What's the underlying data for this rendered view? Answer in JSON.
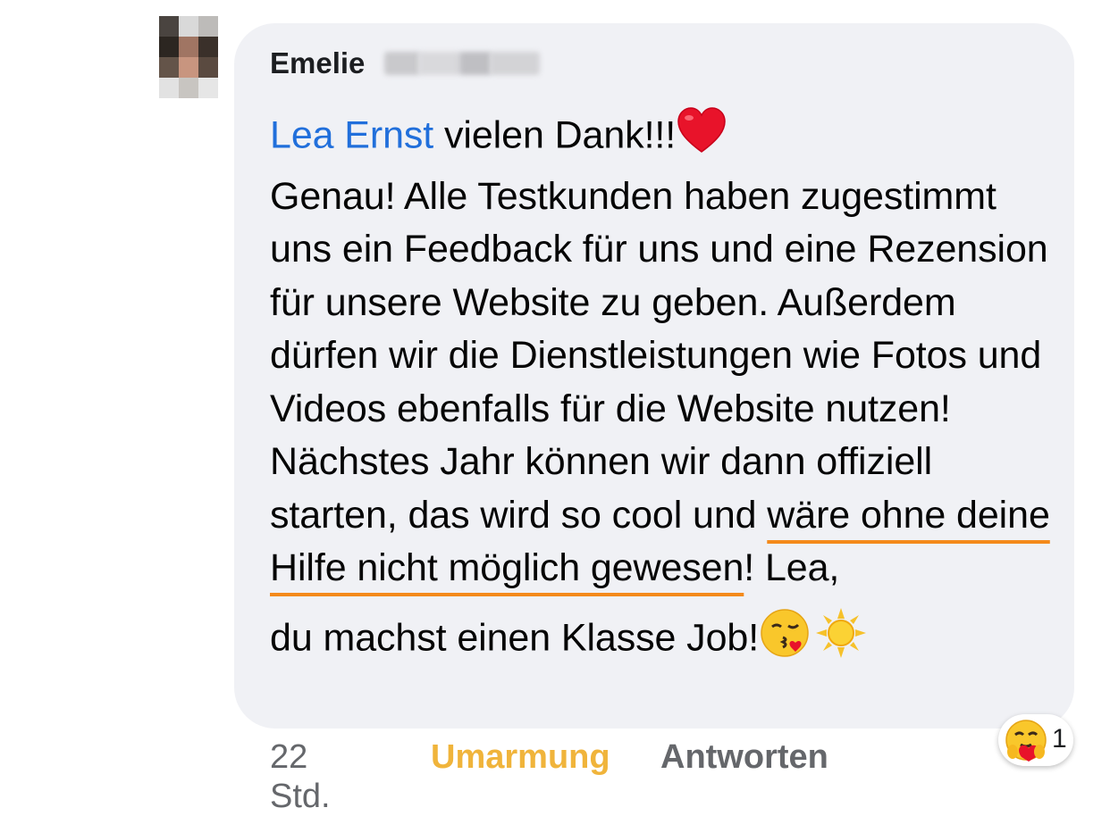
{
  "comment": {
    "author_first": "Emelie",
    "mention": "Lea Ernst",
    "first_line": " vielen Dank!!!",
    "body_before": "Genau! Alle Testkunden haben zugestimmt uns ein Feedback für uns und eine Rezension für unsere Website zu geben. Außerdem dürfen wir die Dienstleistungen wie Fotos und Videos ebenfalls für die Website nutzen! Nächstes Jahr können wir dann offiziell starten, das wird so cool und ",
    "highlight": "wäre ohne deine Hilfe nicht möglich gewesen",
    "after_highlight": "! Lea,",
    "last_line": "du machst einen Klasse Job!",
    "emojis": [
      "heart-emoji",
      "kiss-emoji",
      "sun-emoji"
    ]
  },
  "actions": {
    "time": "22 Std.",
    "hug_label": "Umarmung",
    "reply_label": "Antworten"
  },
  "reaction": {
    "icon": "care-reaction-icon",
    "count": "1"
  },
  "colors": {
    "mention": "#216fdb",
    "hug_active": "#f0b43b",
    "highlight_underline": "#f48a1b",
    "bubble_bg": "#f0f1f5"
  }
}
